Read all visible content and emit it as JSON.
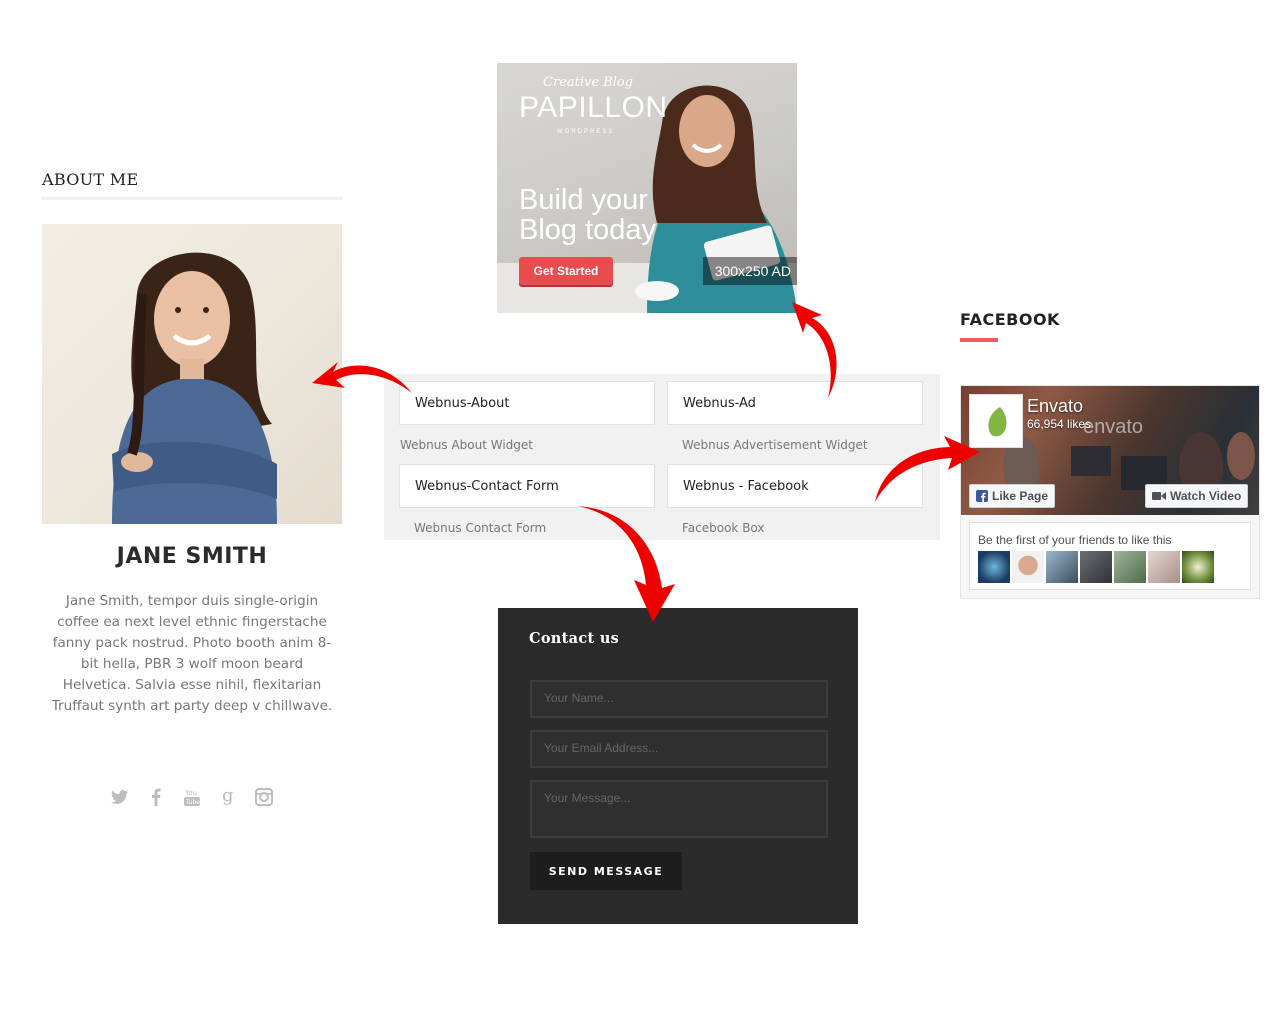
{
  "about": {
    "heading": "ABOUT ME",
    "name": "JANE SMITH",
    "bio": "Jane Smith, tempor duis single-origin coffee ea next level ethnic fingerstache fanny pack nostrud. Photo booth anim 8-bit hella, PBR 3 wolf moon beard Helvetica. Salvia esse nihil, flexitarian Truffaut synth art party deep v chillwave.",
    "socials": [
      "twitter-icon",
      "facebook-icon",
      "youtube-icon",
      "google-plus-icon",
      "instagram-icon"
    ]
  },
  "ad": {
    "script_text": "Creative Blog",
    "brand": "PAPILLON",
    "brand_sub": "WORDPRESS",
    "headline_line1": "Build your",
    "headline_line2": "Blog today",
    "cta_label": "Get Started",
    "size_label": "300x250 AD"
  },
  "widgets": [
    {
      "title": "Webnus-About",
      "desc": "Webnus About Widget"
    },
    {
      "title": "Webnus-Ad",
      "desc": "Webnus Advertisement Widget"
    },
    {
      "title": "Webnus-Contact Form",
      "desc": "Webnus Contact Form"
    },
    {
      "title": "Webnus - Facebook",
      "desc": "Facebook Box"
    }
  ],
  "contact": {
    "title": "Contact us",
    "name_placeholder": "Your Name...",
    "email_placeholder": "Your Email Address...",
    "message_placeholder": "Your Message...",
    "send_label": "SEND MESSAGE"
  },
  "facebook": {
    "heading": "FACEBOOK",
    "page_name": "Envato",
    "likes": "66,954 likes",
    "watermark": "envato",
    "like_label": "Like Page",
    "watch_label": "Watch Video",
    "friends_text": "Be the first of your friends to like this"
  },
  "colors": {
    "accent_red": "#ee5b5b",
    "cta_red": "#e84c4f",
    "contact_bg": "#2b2b2b",
    "envato_green": "#82b541",
    "facebook_blue": "#3b5998"
  }
}
